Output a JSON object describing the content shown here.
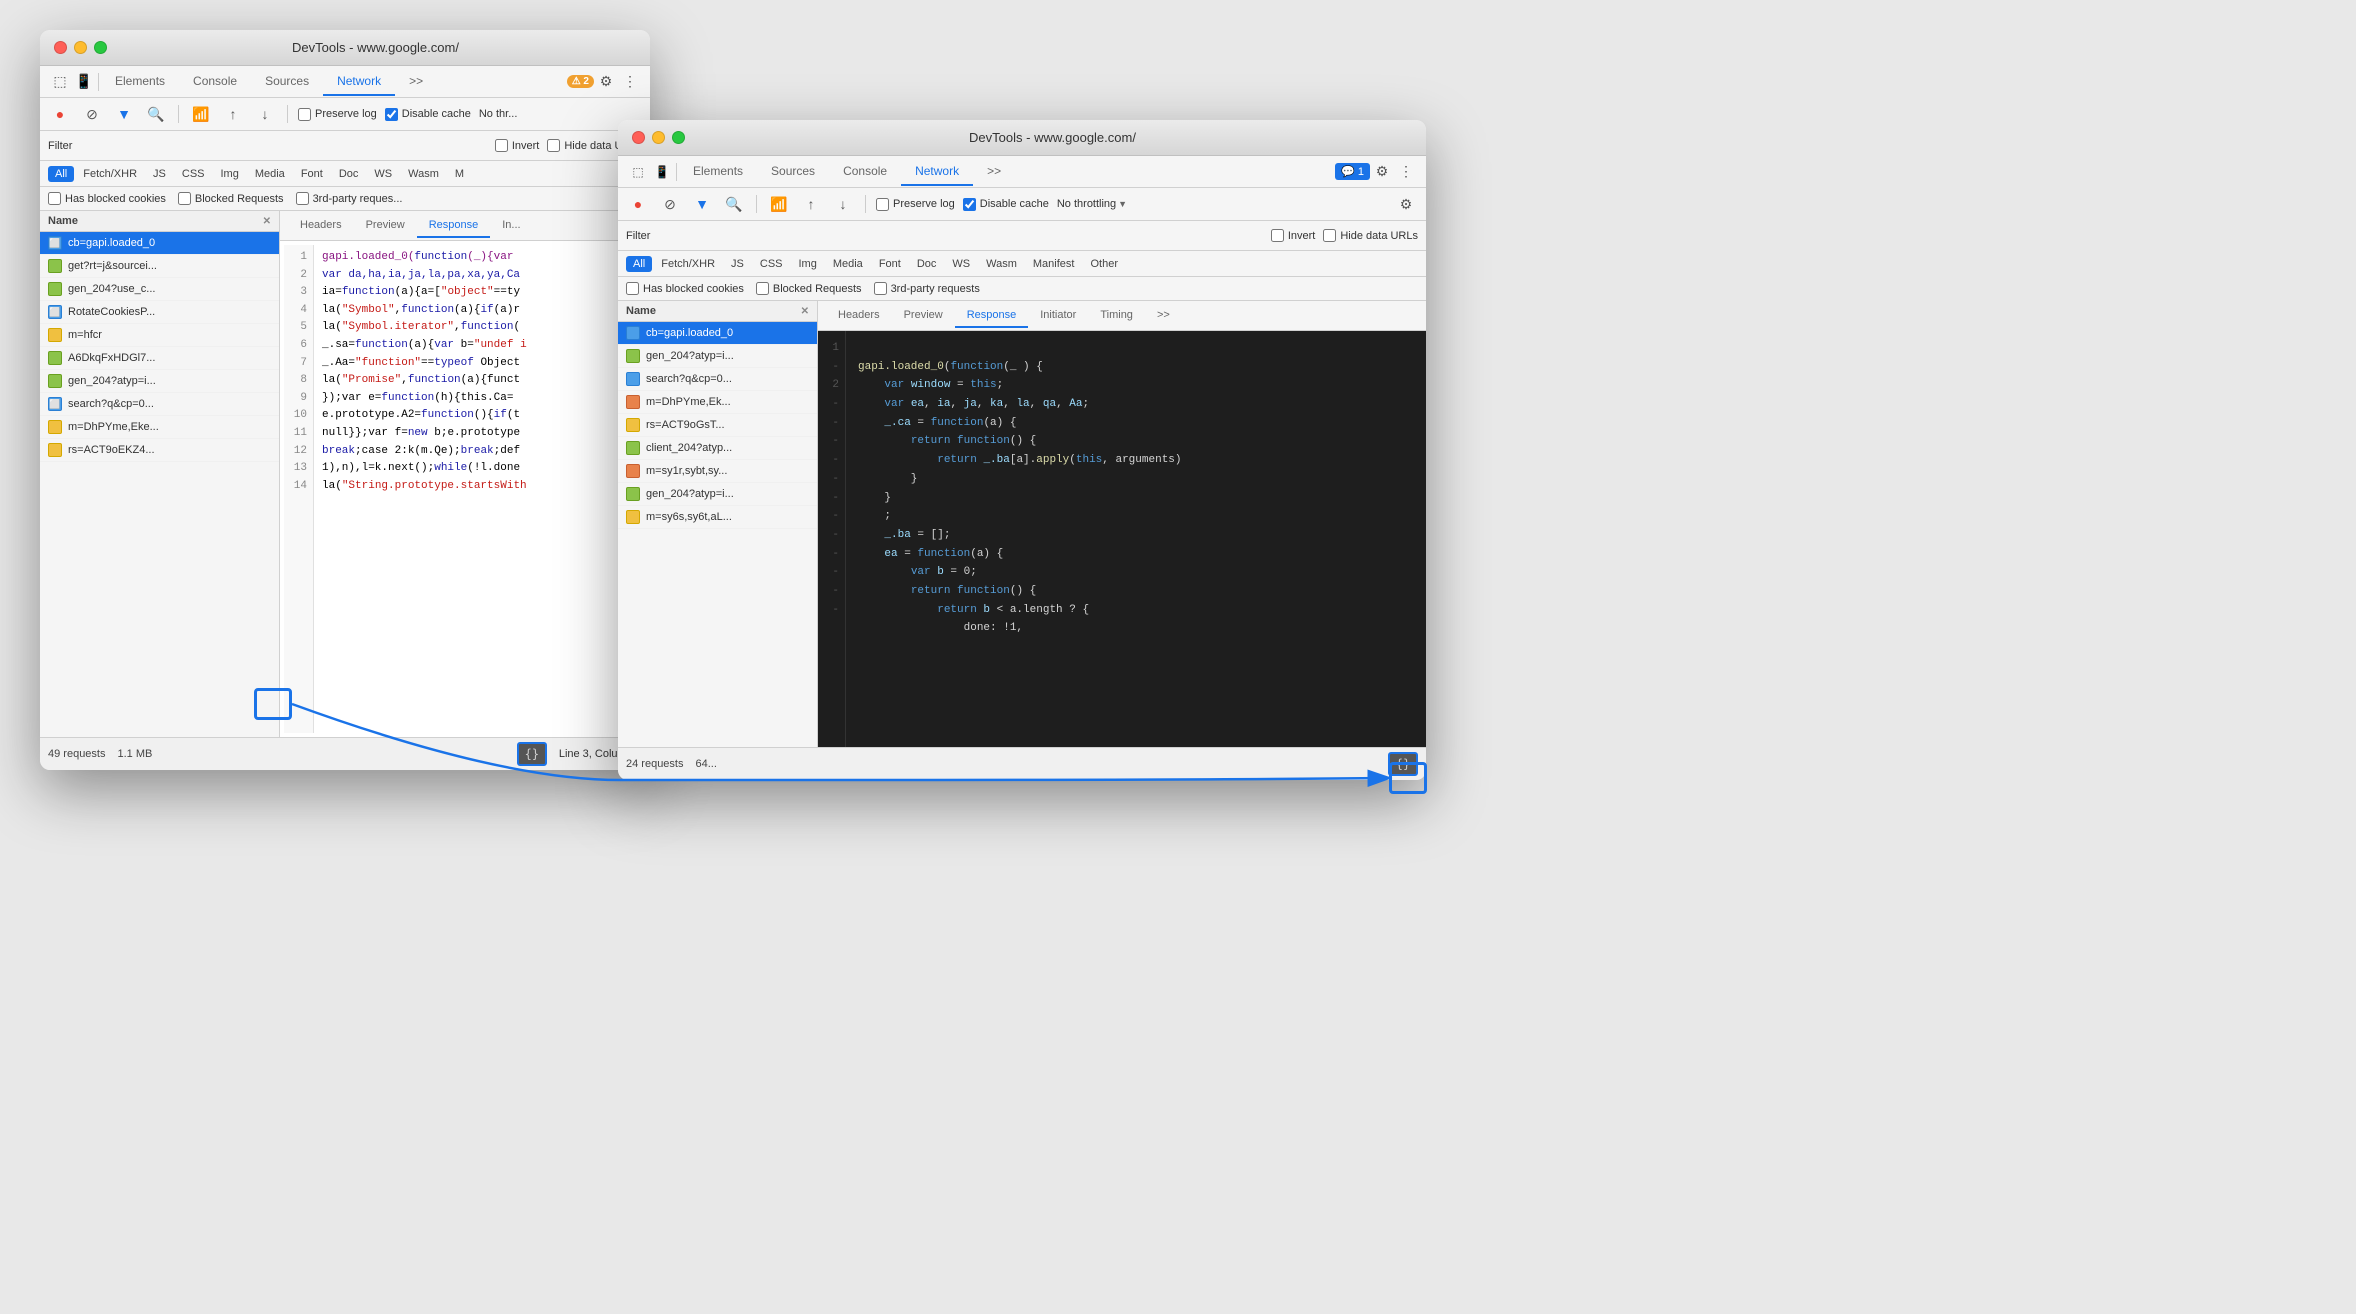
{
  "window1": {
    "title": "DevTools - www.google.com/",
    "tabs": [
      "Elements",
      "Console",
      "Sources",
      "Network",
      ">>"
    ],
    "active_tab": "Network",
    "toolbar": {
      "record": "●",
      "block": "⊘",
      "filter_icon": "▼",
      "search_icon": "🔍",
      "preserve_log": "Preserve log",
      "disable_cache": "Disable cache",
      "no_throttling": "No thr..."
    },
    "filter_label": "Filter",
    "invert_label": "Invert",
    "hide_data_urls": "Hide data URLs",
    "type_filters": [
      "All",
      "Fetch/XHR",
      "JS",
      "CSS",
      "Img",
      "Media",
      "Font",
      "Doc",
      "WS",
      "Wasm",
      "M"
    ],
    "has_blocked_cookies": "Has blocked cookies",
    "blocked_requests": "Blocked Requests",
    "third_party": "3rd-party reques...",
    "list_header": "Name",
    "items": [
      {
        "name": "cb=gapi.loaded_0",
        "type": "doc",
        "selected": true
      },
      {
        "name": "get?rt=j&sourcei...",
        "type": "xhr"
      },
      {
        "name": "gen_204?use_c...",
        "type": "xhr"
      },
      {
        "name": "RotateCookiesP...",
        "type": "doc"
      },
      {
        "name": "m=hfcr",
        "type": "js"
      },
      {
        "name": "A6DkqFxHDGl7...",
        "type": "xhr"
      },
      {
        "name": "gen_204?atyp=i...",
        "type": "xhr"
      },
      {
        "name": "search?q&cp=0...",
        "type": "doc"
      },
      {
        "name": "m=DhPYme,Eke...",
        "type": "js"
      },
      {
        "name": "rs=ACT9oEKZ4...",
        "type": "js"
      }
    ],
    "status": "49 requests",
    "size": "1.1 MB",
    "position": "Line 3, Column 5",
    "code_lines": [
      {
        "num": "1",
        "text": "gapi.loaded_0(function(_){var"
      },
      {
        "num": "2",
        "text": "var da,ha,ia,ja,la,pa,xa,ya,Ca"
      },
      {
        "num": "3",
        "text": "ia=function(a){a=[\"object\"==ty"
      },
      {
        "num": "4",
        "text": "la(\"Symbol\",function(a){if(a)r"
      },
      {
        "num": "5",
        "text": "la(\"Symbol.iterator\",function("
      },
      {
        "num": "6",
        "text": "_.sa=function(a){var b=\"undef i"
      },
      {
        "num": "7",
        "text": "_.Aa=\"function\"==typeof Object"
      },
      {
        "num": "8",
        "text": "la(\"Promise\",function(a){funct"
      },
      {
        "num": "9",
        "text": "});var e=function(h){this.Ca="
      },
      {
        "num": "10",
        "text": "e.prototype.A2=function(){if(t"
      },
      {
        "num": "11",
        "text": "null}};var f=new b;e.prototype"
      },
      {
        "num": "12",
        "text": "break;case 2:k(m.Qe);break;def"
      },
      {
        "num": "13",
        "text": "1),n),l=k.next();while(!l.done"
      },
      {
        "num": "14",
        "text": "la(\"String.prototype.startsWit"
      }
    ]
  },
  "window2": {
    "title": "DevTools - www.google.com/",
    "tabs": [
      "Elements",
      "Sources",
      "Console",
      "Network",
      ">>"
    ],
    "active_tab": "Network",
    "badge": "1",
    "toolbar": {
      "preserve_log": "Preserve log",
      "disable_cache": "Disable cache",
      "no_throttling": "No throttling"
    },
    "filter_label": "Filter",
    "invert_label": "Invert",
    "hide_data_urls": "Hide data URLs",
    "type_filters": [
      "All",
      "Fetch/XHR",
      "JS",
      "CSS",
      "Img",
      "Media",
      "Font",
      "Doc",
      "WS",
      "Wasm",
      "Manifest",
      "Other"
    ],
    "active_type": "All",
    "has_blocked_cookies": "Has blocked cookies",
    "blocked_requests": "Blocked Requests",
    "third_party": "3rd-party requests",
    "list_header": "Name",
    "items": [
      {
        "name": "cb=gapi.loaded_0",
        "type": "doc",
        "selected": true
      },
      {
        "name": "gen_204?atyp=i...",
        "type": "xhr"
      },
      {
        "name": "search?q&cp=0...",
        "type": "doc"
      },
      {
        "name": "m=DhPYme,Ek...",
        "type": "js"
      },
      {
        "name": "rs=ACT9oGsT...",
        "type": "js"
      },
      {
        "name": "client_204?atyp...",
        "type": "xhr"
      },
      {
        "name": "m=sy1r,sybt,sy...",
        "type": "js"
      },
      {
        "name": "gen_204?atyp=i...",
        "type": "xhr"
      },
      {
        "name": "m=sy6s,sy6t,aL...",
        "type": "js"
      }
    ],
    "status": "24 requests",
    "size": "64...",
    "detail_tabs": [
      "Headers",
      "Preview",
      "Response",
      "Initiator",
      "Timing",
      ">>"
    ],
    "active_detail_tab": "Response",
    "code_lines": [
      {
        "num": "1",
        "dash": "",
        "text": "gapi.loaded_0(function(_ ) {"
      },
      {
        "num": "-",
        "dash": "-",
        "text": "    var window = this;"
      },
      {
        "num": "2",
        "dash": "",
        "text": "    var ea, ia, ja, ka, la, qa, Aa;"
      },
      {
        "num": "-",
        "dash": "-",
        "text": "    _.ca = function(a) {"
      },
      {
        "num": "-",
        "dash": "-",
        "text": "        return function() {"
      },
      {
        "num": "-",
        "dash": "-",
        "text": "            return _.ba[a].apply(this, arguments)"
      },
      {
        "num": "-",
        "dash": "-",
        "text": "        }"
      },
      {
        "num": "-",
        "dash": "-",
        "text": "    }"
      },
      {
        "num": "-",
        "dash": "-",
        "text": "    ;"
      },
      {
        "num": "-",
        "dash": "-",
        "text": "    _.ba = [];"
      },
      {
        "num": "-",
        "dash": "-",
        "text": "    ea = function(a) {"
      },
      {
        "num": "-",
        "dash": "-",
        "text": "        var b = 0;"
      },
      {
        "num": "-",
        "dash": "-",
        "text": "        return function() {"
      },
      {
        "num": "-",
        "dash": "-",
        "text": "            return b < a.length ? {"
      },
      {
        "num": "-",
        "dash": "-",
        "text": "                done: !1,"
      }
    ]
  }
}
